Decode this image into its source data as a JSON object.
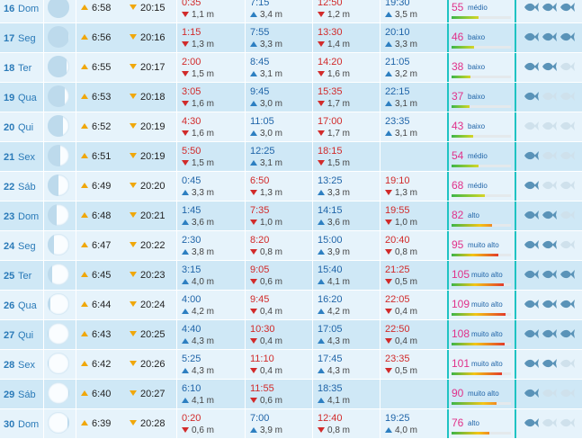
{
  "colors": {
    "row_even": "#e6f3fb",
    "row_odd": "#cfe8f6",
    "coef_value": "#e0318a",
    "fish_on": "#5a93b8",
    "fish_off": "#cfe1ec",
    "sun_arrow": "#f0a70a"
  },
  "unit": "m",
  "rows": [
    {
      "day": "16",
      "weekday": "Dom",
      "moon_lit": 0.02,
      "moon_waxing": true,
      "sunrise": "6:58",
      "sunset": "20:15",
      "tides": [
        {
          "time": "0:35",
          "height": "1,1 m",
          "type": "low"
        },
        {
          "time": "7:15",
          "height": "3,4 m",
          "type": "high"
        },
        {
          "time": "12:50",
          "height": "1,2 m",
          "type": "low"
        },
        {
          "time": "19:30",
          "height": "3,5 m",
          "type": "high"
        }
      ],
      "coef": "55",
      "coef_label": "médio",
      "fish": 3
    },
    {
      "day": "17",
      "weekday": "Seg",
      "moon_lit": 0.05,
      "moon_waxing": true,
      "sunrise": "6:56",
      "sunset": "20:16",
      "tides": [
        {
          "time": "1:15",
          "height": "1,3 m",
          "type": "low"
        },
        {
          "time": "7:55",
          "height": "3,3 m",
          "type": "high"
        },
        {
          "time": "13:30",
          "height": "1,4 m",
          "type": "low"
        },
        {
          "time": "20:10",
          "height": "3,3 m",
          "type": "high"
        }
      ],
      "coef": "46",
      "coef_label": "baixo",
      "fish": 3
    },
    {
      "day": "18",
      "weekday": "Ter",
      "moon_lit": 0.12,
      "moon_waxing": true,
      "sunrise": "6:55",
      "sunset": "20:17",
      "tides": [
        {
          "time": "2:00",
          "height": "1,5 m",
          "type": "low"
        },
        {
          "time": "8:45",
          "height": "3,1 m",
          "type": "high"
        },
        {
          "time": "14:20",
          "height": "1,6 m",
          "type": "low"
        },
        {
          "time": "21:05",
          "height": "3,2 m",
          "type": "high"
        }
      ],
      "coef": "38",
      "coef_label": "baixo",
      "fish": 2
    },
    {
      "day": "19",
      "weekday": "Qua",
      "moon_lit": 0.2,
      "moon_waxing": true,
      "sunrise": "6:53",
      "sunset": "20:18",
      "tides": [
        {
          "time": "3:05",
          "height": "1,6 m",
          "type": "low"
        },
        {
          "time": "9:45",
          "height": "3,0 m",
          "type": "high"
        },
        {
          "time": "15:35",
          "height": "1,7 m",
          "type": "low"
        },
        {
          "time": "22:15",
          "height": "3,1 m",
          "type": "high"
        }
      ],
      "coef": "37",
      "coef_label": "baixo",
      "fish": 1
    },
    {
      "day": "20",
      "weekday": "Qui",
      "moon_lit": 0.3,
      "moon_waxing": true,
      "sunrise": "6:52",
      "sunset": "20:19",
      "tides": [
        {
          "time": "4:30",
          "height": "1,6 m",
          "type": "low"
        },
        {
          "time": "11:05",
          "height": "3,0 m",
          "type": "high"
        },
        {
          "time": "17:00",
          "height": "1,7 m",
          "type": "low"
        },
        {
          "time": "23:35",
          "height": "3,1 m",
          "type": "high"
        }
      ],
      "coef": "43",
      "coef_label": "baixo",
      "fish": 0
    },
    {
      "day": "21",
      "weekday": "Sex",
      "moon_lit": 0.4,
      "moon_waxing": true,
      "sunrise": "6:51",
      "sunset": "20:19",
      "tides": [
        {
          "time": "5:50",
          "height": "1,5 m",
          "type": "low"
        },
        {
          "time": "12:25",
          "height": "3,1 m",
          "type": "high"
        },
        {
          "time": "18:15",
          "height": "1,5 m",
          "type": "low"
        }
      ],
      "coef": "54",
      "coef_label": "médio",
      "fish": 1
    },
    {
      "day": "22",
      "weekday": "Sáb",
      "moon_lit": 0.5,
      "moon_waxing": true,
      "sunrise": "6:49",
      "sunset": "20:20",
      "tides": [
        {
          "time": "0:45",
          "height": "3,3 m",
          "type": "high"
        },
        {
          "time": "6:50",
          "height": "1,3 m",
          "type": "low"
        },
        {
          "time": "13:25",
          "height": "3,3 m",
          "type": "high"
        },
        {
          "time": "19:10",
          "height": "1,3 m",
          "type": "low"
        }
      ],
      "coef": "68",
      "coef_label": "médio",
      "fish": 1
    },
    {
      "day": "23",
      "weekday": "Dom",
      "moon_lit": 0.6,
      "moon_waxing": true,
      "sunrise": "6:48",
      "sunset": "20:21",
      "tides": [
        {
          "time": "1:45",
          "height": "3,6 m",
          "type": "high"
        },
        {
          "time": "7:35",
          "height": "1,0 m",
          "type": "low"
        },
        {
          "time": "14:15",
          "height": "3,6 m",
          "type": "high"
        },
        {
          "time": "19:55",
          "height": "1,0 m",
          "type": "low"
        }
      ],
      "coef": "82",
      "coef_label": "alto",
      "fish": 2
    },
    {
      "day": "24",
      "weekday": "Seg",
      "moon_lit": 0.7,
      "moon_waxing": true,
      "sunrise": "6:47",
      "sunset": "20:22",
      "tides": [
        {
          "time": "2:30",
          "height": "3,8 m",
          "type": "high"
        },
        {
          "time": "8:20",
          "height": "0,8 m",
          "type": "low"
        },
        {
          "time": "15:00",
          "height": "3,9 m",
          "type": "high"
        },
        {
          "time": "20:40",
          "height": "0,8 m",
          "type": "low"
        }
      ],
      "coef": "95",
      "coef_label": "muito alto",
      "fish": 2
    },
    {
      "day": "25",
      "weekday": "Ter",
      "moon_lit": 0.8,
      "moon_waxing": true,
      "sunrise": "6:45",
      "sunset": "20:23",
      "tides": [
        {
          "time": "3:15",
          "height": "4,0 m",
          "type": "high"
        },
        {
          "time": "9:05",
          "height": "0,6 m",
          "type": "low"
        },
        {
          "time": "15:40",
          "height": "4,1 m",
          "type": "high"
        },
        {
          "time": "21:25",
          "height": "0,5 m",
          "type": "low"
        }
      ],
      "coef": "105",
      "coef_label": "muito alto",
      "fish": 3
    },
    {
      "day": "26",
      "weekday": "Qua",
      "moon_lit": 0.88,
      "moon_waxing": true,
      "sunrise": "6:44",
      "sunset": "20:24",
      "tides": [
        {
          "time": "4:00",
          "height": "4,2 m",
          "type": "high"
        },
        {
          "time": "9:45",
          "height": "0,4 m",
          "type": "low"
        },
        {
          "time": "16:20",
          "height": "4,2 m",
          "type": "high"
        },
        {
          "time": "22:05",
          "height": "0,4 m",
          "type": "low"
        }
      ],
      "coef": "109",
      "coef_label": "muito alto",
      "fish": 3
    },
    {
      "day": "27",
      "weekday": "Qui",
      "moon_lit": 0.95,
      "moon_waxing": true,
      "sunrise": "6:43",
      "sunset": "20:25",
      "tides": [
        {
          "time": "4:40",
          "height": "4,3 m",
          "type": "high"
        },
        {
          "time": "10:30",
          "height": "0,4 m",
          "type": "low"
        },
        {
          "time": "17:05",
          "height": "4,3 m",
          "type": "high"
        },
        {
          "time": "22:50",
          "height": "0,4 m",
          "type": "low"
        }
      ],
      "coef": "108",
      "coef_label": "muito alto",
      "fish": 3
    },
    {
      "day": "28",
      "weekday": "Sex",
      "moon_lit": 0.99,
      "moon_waxing": true,
      "sunrise": "6:42",
      "sunset": "20:26",
      "tides": [
        {
          "time": "5:25",
          "height": "4,3 m",
          "type": "high"
        },
        {
          "time": "11:10",
          "height": "0,4 m",
          "type": "low"
        },
        {
          "time": "17:45",
          "height": "4,3 m",
          "type": "high"
        },
        {
          "time": "23:35",
          "height": "0,5 m",
          "type": "low"
        }
      ],
      "coef": "101",
      "coef_label": "muito alto",
      "fish": 2
    },
    {
      "day": "29",
      "weekday": "Sáb",
      "moon_lit": 0.97,
      "moon_waxing": false,
      "sunrise": "6:40",
      "sunset": "20:27",
      "tides": [
        {
          "time": "6:10",
          "height": "4,1 m",
          "type": "high"
        },
        {
          "time": "11:55",
          "height": "0,6 m",
          "type": "low"
        },
        {
          "time": "18:35",
          "height": "4,1 m",
          "type": "high"
        }
      ],
      "coef": "90",
      "coef_label": "muito alto",
      "fish": 1
    },
    {
      "day": "30",
      "weekday": "Dom",
      "moon_lit": 0.92,
      "moon_waxing": false,
      "sunrise": "6:39",
      "sunset": "20:28",
      "tides": [
        {
          "time": "0:20",
          "height": "0,6 m",
          "type": "low"
        },
        {
          "time": "7:00",
          "height": "3,9 m",
          "type": "high"
        },
        {
          "time": "12:40",
          "height": "0,8 m",
          "type": "low"
        },
        {
          "time": "19:25",
          "height": "4,0 m",
          "type": "high"
        }
      ],
      "coef": "76",
      "coef_label": "alto",
      "fish": 1
    }
  ]
}
